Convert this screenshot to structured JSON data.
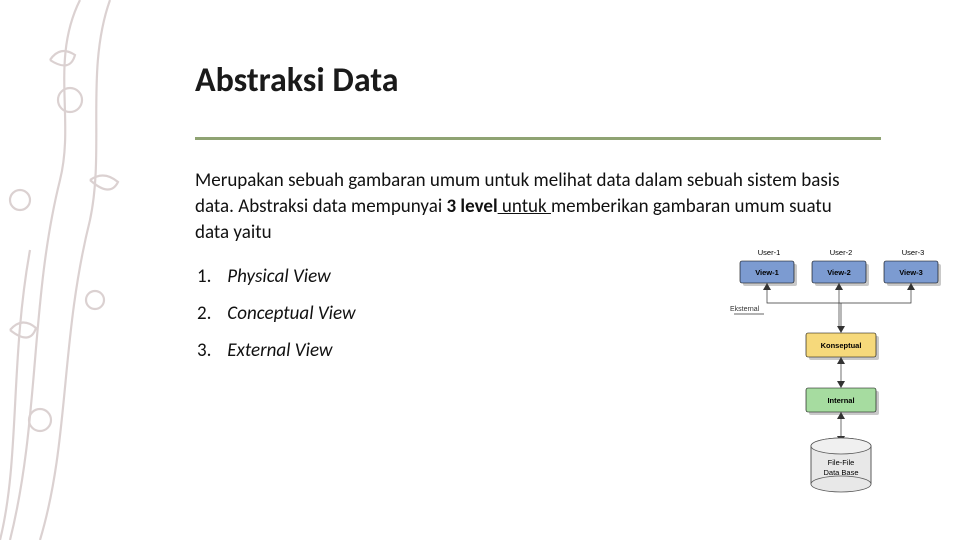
{
  "title": "Abstraksi Data",
  "description": {
    "pre": "Merupakan sebuah gambaran umum untuk melihat data dalam sebuah sistem basis data. Abstraksi data mempunyai ",
    "bold": "3 level",
    "post_u": " untuk ",
    "post": "memberikan gambaran umum suatu data yaitu"
  },
  "list": [
    {
      "num": "1.",
      "label": "Physical View"
    },
    {
      "num": "2.",
      "label": "Conceptual View"
    },
    {
      "num": "3.",
      "label": "External View"
    }
  ],
  "diagram": {
    "users": [
      "User-1",
      "User-2",
      "User-3"
    ],
    "views": [
      "View-1",
      "View-2",
      "View-3"
    ],
    "external_label": "Eksternal",
    "konseptual": "Konseptual",
    "internal": "Internal",
    "db_top": "File-File",
    "db_bot": "Data Base"
  }
}
